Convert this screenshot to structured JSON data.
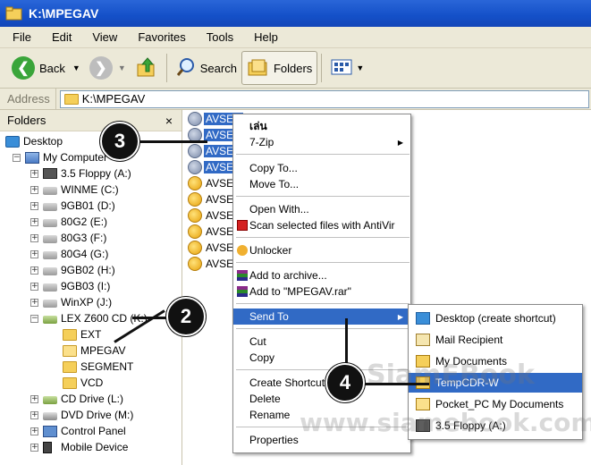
{
  "window": {
    "title": "K:\\MPEGAV"
  },
  "menu": [
    "File",
    "Edit",
    "View",
    "Favorites",
    "Tools",
    "Help"
  ],
  "toolbar": {
    "back": "Back",
    "search": "Search",
    "folders": "Folders"
  },
  "address": {
    "label": "Address",
    "value": "K:\\MPEGAV"
  },
  "folders_pane": {
    "title": "Folders",
    "close": "×",
    "tree": [
      {
        "label": "Desktop",
        "icon": "desktop-icon"
      },
      {
        "label": "My Computer",
        "icon": "computer-icon"
      },
      {
        "label": "3.5 Floppy (A:)",
        "icon": "floppy-icon"
      },
      {
        "label": "WINME (C:)",
        "icon": "drive-icon"
      },
      {
        "label": "9GB01 (D:)",
        "icon": "drive-icon"
      },
      {
        "label": "80G2 (E:)",
        "icon": "drive-icon"
      },
      {
        "label": "80G3 (F:)",
        "icon": "drive-icon"
      },
      {
        "label": "80G4 (G:)",
        "icon": "drive-icon"
      },
      {
        "label": "9GB02 (H:)",
        "icon": "drive-icon"
      },
      {
        "label": "9GB03 (I:)",
        "icon": "drive-icon"
      },
      {
        "label": "WinXP (J:)",
        "icon": "drive-icon"
      },
      {
        "label": "LEX Z600 CD (K:)",
        "icon": "cd-drive-icon"
      },
      {
        "label": "EXT",
        "icon": "folder-icon"
      },
      {
        "label": "MPEGAV",
        "icon": "folder-icon"
      },
      {
        "label": "SEGMENT",
        "icon": "folder-icon"
      },
      {
        "label": "VCD",
        "icon": "folder-icon"
      },
      {
        "label": "CD Drive (L:)",
        "icon": "cd-drive-icon"
      },
      {
        "label": "DVD Drive (M:)",
        "icon": "dvd-drive-icon"
      },
      {
        "label": "Control Panel",
        "icon": "control-panel-icon"
      },
      {
        "label": "Mobile Device",
        "icon": "mobile-device-icon"
      }
    ]
  },
  "files": [
    "AVSEQ",
    "AVSEQ",
    "AVSEQ",
    "AVSEQ",
    "AVSEC",
    "AVSEC",
    "AVSEC",
    "AVSEC",
    "AVSEC",
    "AVSEC"
  ],
  "context_menu": {
    "play": "เล่น",
    "zip": "7-Zip",
    "copy_to": "Copy To...",
    "move_to": "Move To...",
    "open_with": "Open With...",
    "scan": "Scan selected files with AntiVir",
    "unlocker": "Unlocker",
    "add_archive": "Add to archive...",
    "add_rar": "Add to \"MPEGAV.rar\"",
    "send_to": "Send To",
    "cut": "Cut",
    "copy": "Copy",
    "create_shortcut": "Create Shortcut",
    "delete": "Delete",
    "rename": "Rename",
    "properties": "Properties"
  },
  "send_to_menu": [
    "Desktop (create shortcut)",
    "Mail Recipient",
    "My Documents",
    "TempCDR-W",
    "Pocket_PC My Documents",
    "3.5 Floppy (A:)"
  ],
  "callouts": [
    "2",
    "3",
    "4"
  ],
  "watermark": {
    "line1": "SiamEBook",
    "line2": "www.siamebook.com"
  },
  "colors": {
    "selection": "#316ac5",
    "titlebar": "#1450c8",
    "chrome": "#ece9d8"
  }
}
